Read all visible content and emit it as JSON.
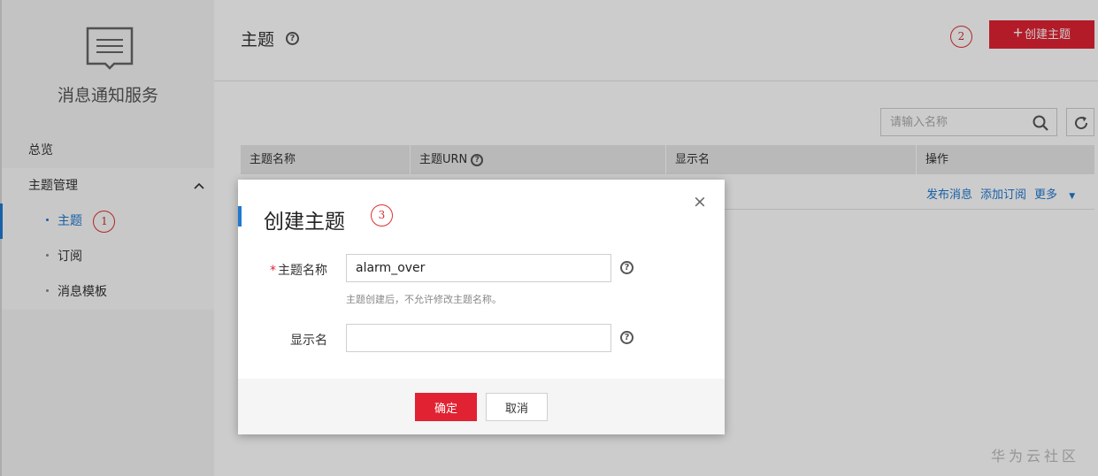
{
  "sidebar": {
    "service_name": "消息通知服务",
    "overview": "总览",
    "group_label": "主题管理",
    "items": [
      {
        "label": "主题"
      },
      {
        "label": "订阅"
      },
      {
        "label": "消息模板"
      }
    ],
    "topic_marker": "1"
  },
  "header": {
    "title": "主题",
    "create_marker": "2",
    "create_label": "创建主题"
  },
  "search": {
    "placeholder": "请输入名称"
  },
  "table": {
    "columns": [
      "主题名称",
      "主题URN",
      "显示名",
      "操作"
    ],
    "row_actions": [
      "发布消息",
      "添加订阅",
      "更多"
    ]
  },
  "dialog": {
    "title": "创建主题",
    "marker": "3",
    "close": "×",
    "name_label": "主题名称",
    "name_value": "alarm_over",
    "name_hint": "主题创建后，不允许修改主题名称。",
    "display_label": "显示名",
    "display_value": "",
    "ok_label": "确定",
    "cancel_label": "取消"
  },
  "watermark": "华为云社区",
  "colors": {
    "accent": "#e02232",
    "link": "#1f78d1"
  }
}
